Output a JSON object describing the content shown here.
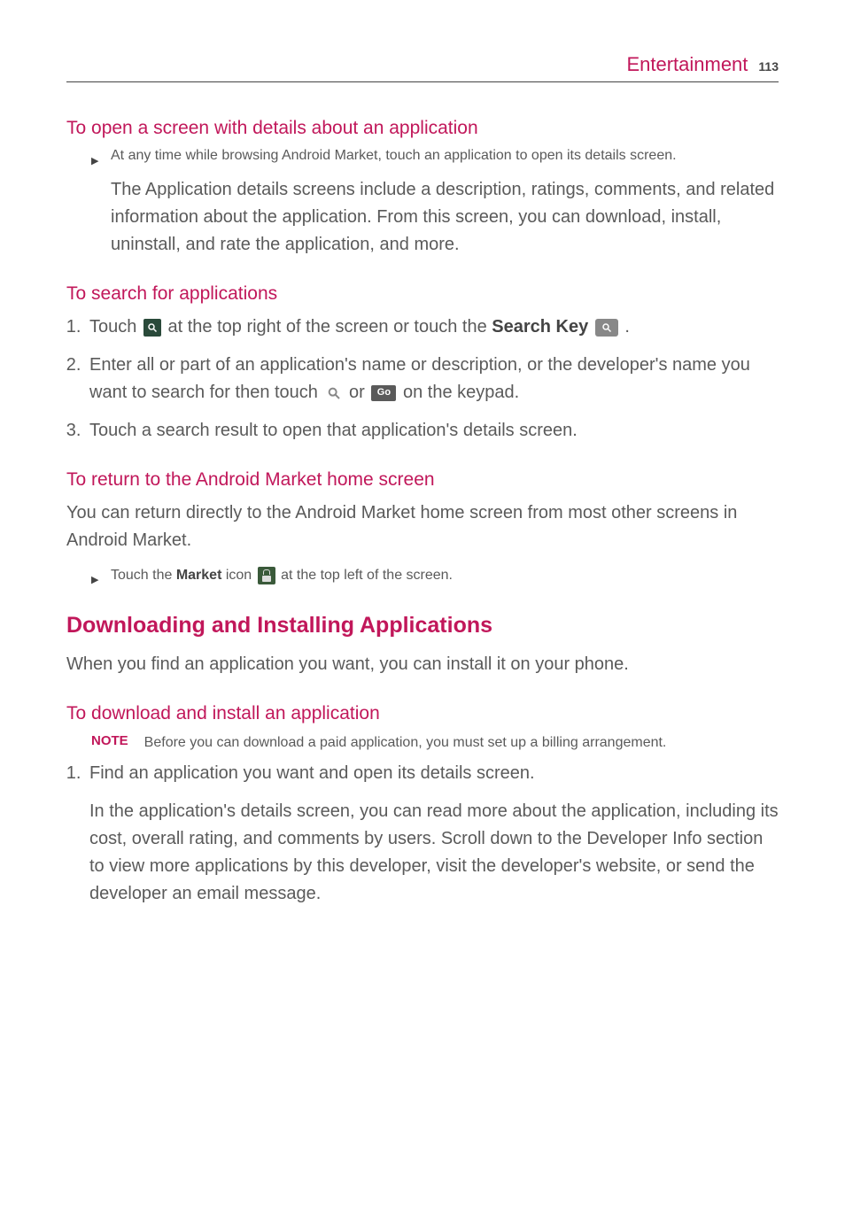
{
  "header": {
    "title": "Entertainment",
    "page": "113"
  },
  "s1": {
    "heading": "To open a screen with details about an application",
    "b1": "At any time while browsing Android Market, touch an application to open its details screen.",
    "p1": "The Application details screens include a description, ratings, comments, and related information about the application. From this screen, you can download, install, uninstall, and rate the application, and more."
  },
  "s2": {
    "heading": "To search for applications",
    "li1a": "Touch ",
    "li1b": " at the top right of the screen or touch the ",
    "li1_bold": "Search Key",
    "li1c": " .",
    "li2a": "Enter all or part of an application's name or description, or the developer's name you want to search for then touch ",
    "li2b": " or ",
    "li2c": " on the keypad.",
    "go_label": "Go",
    "li3": "Touch a search result to open that application's details screen."
  },
  "s3": {
    "heading": "To return to the Android Market home screen",
    "p1": "You can return directly to the Android Market home screen from most other screens in Android Market.",
    "b1a": "Touch the ",
    "b1_bold": "Market",
    "b1b": " icon ",
    "b1c": " at the top left of the screen."
  },
  "s4": {
    "heading": "Downloading and Installing Applications",
    "p1": "When you find an application you want, you can install it on your phone."
  },
  "s5": {
    "heading": "To download and install an application",
    "note_label": "NOTE",
    "note_text": "Before you can download a paid application, you must set up a billing arrangement.",
    "li1": "Find an application you want and open its details screen.",
    "p1": "In the application's details screen, you can read more about the application, including its cost, overall rating, and comments by users. Scroll down to the Developer Info section to view more applications by this developer, visit the developer's website, or send the developer an email message."
  }
}
